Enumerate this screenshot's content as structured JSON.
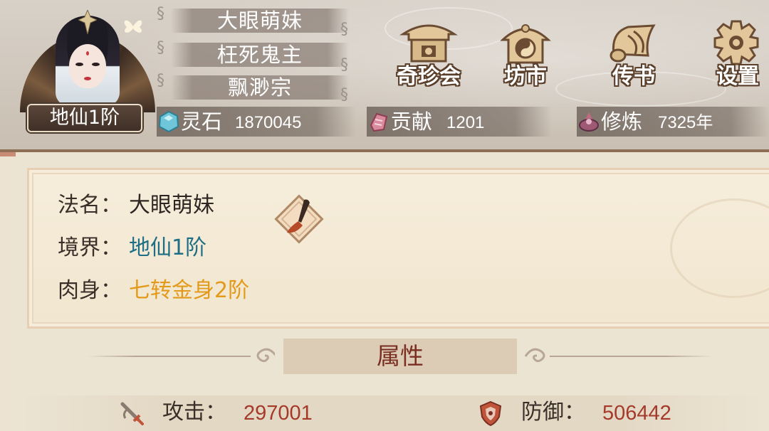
{
  "player": {
    "realm_badge": "地仙1阶",
    "names": [
      "大眼萌妹",
      "枉死鬼主",
      "飘渺宗"
    ]
  },
  "resources": [
    {
      "icon": "spirit-stone-icon",
      "label": "灵石",
      "value": "1870045"
    },
    {
      "icon": "contribution-icon",
      "label": "贡献",
      "value": "1201"
    },
    {
      "icon": "cultivation-icon",
      "label": "修炼",
      "value": "7325年"
    }
  ],
  "menu": [
    {
      "icon": "treasure-pavilion-icon",
      "label": "奇珍会"
    },
    {
      "icon": "market-icon",
      "label": "坊市"
    },
    {
      "icon": "letter-scroll-icon",
      "label": "传书"
    },
    {
      "icon": "settings-gear-icon",
      "label": "设置"
    }
  ],
  "info": {
    "dharma_name_key": "法名：",
    "dharma_name": "大眼萌妹",
    "realm_key": "境界：",
    "realm": "地仙1阶",
    "body_key": "肉身：",
    "body": "七转金身2阶"
  },
  "section": {
    "title": "属性"
  },
  "stats": [
    {
      "icon": "sword-icon",
      "label": "攻击：",
      "value": "297001"
    },
    {
      "icon": "shield-icon",
      "label": "防御：",
      "value": "506442"
    }
  ],
  "colors": {
    "realm_text": "#1e6e86",
    "body_text": "#e39a1a",
    "stat_value": "#a53a2b",
    "section_title": "#7a2e22"
  }
}
